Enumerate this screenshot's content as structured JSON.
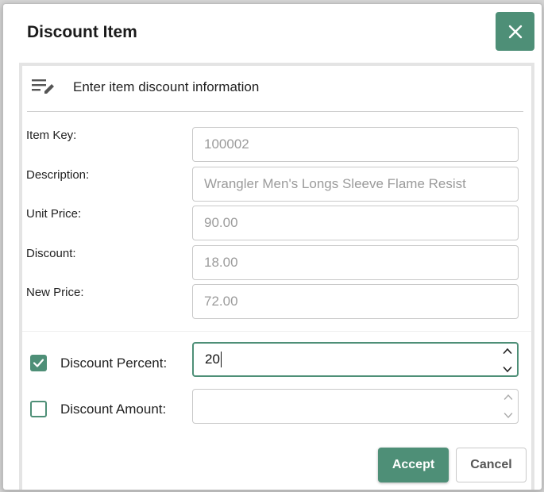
{
  "dialog": {
    "title": "Discount Item",
    "close_icon": "close-icon",
    "heading": "Enter item discount information",
    "heading_icon": "edit-list-icon"
  },
  "fields": [
    {
      "label": "Item Key:",
      "value": "100002"
    },
    {
      "label": "Description:",
      "value": "Wrangler Men's Longs Sleeve Flame Resist"
    },
    {
      "label": "Unit Price:",
      "value": "90.00"
    },
    {
      "label": "Discount:",
      "value": "18.00"
    },
    {
      "label": "New Price:",
      "value": "72.00"
    }
  ],
  "discount_percent": {
    "label": "Discount Percent:",
    "checked": true,
    "value": "20"
  },
  "discount_amount": {
    "label": "Discount Amount:",
    "checked": false,
    "value": ""
  },
  "buttons": {
    "accept": "Accept",
    "cancel": "Cancel"
  },
  "colors": {
    "accent": "#4e8f77",
    "placeholder_text": "#9b9b9b",
    "border": "#c9c9c9"
  }
}
